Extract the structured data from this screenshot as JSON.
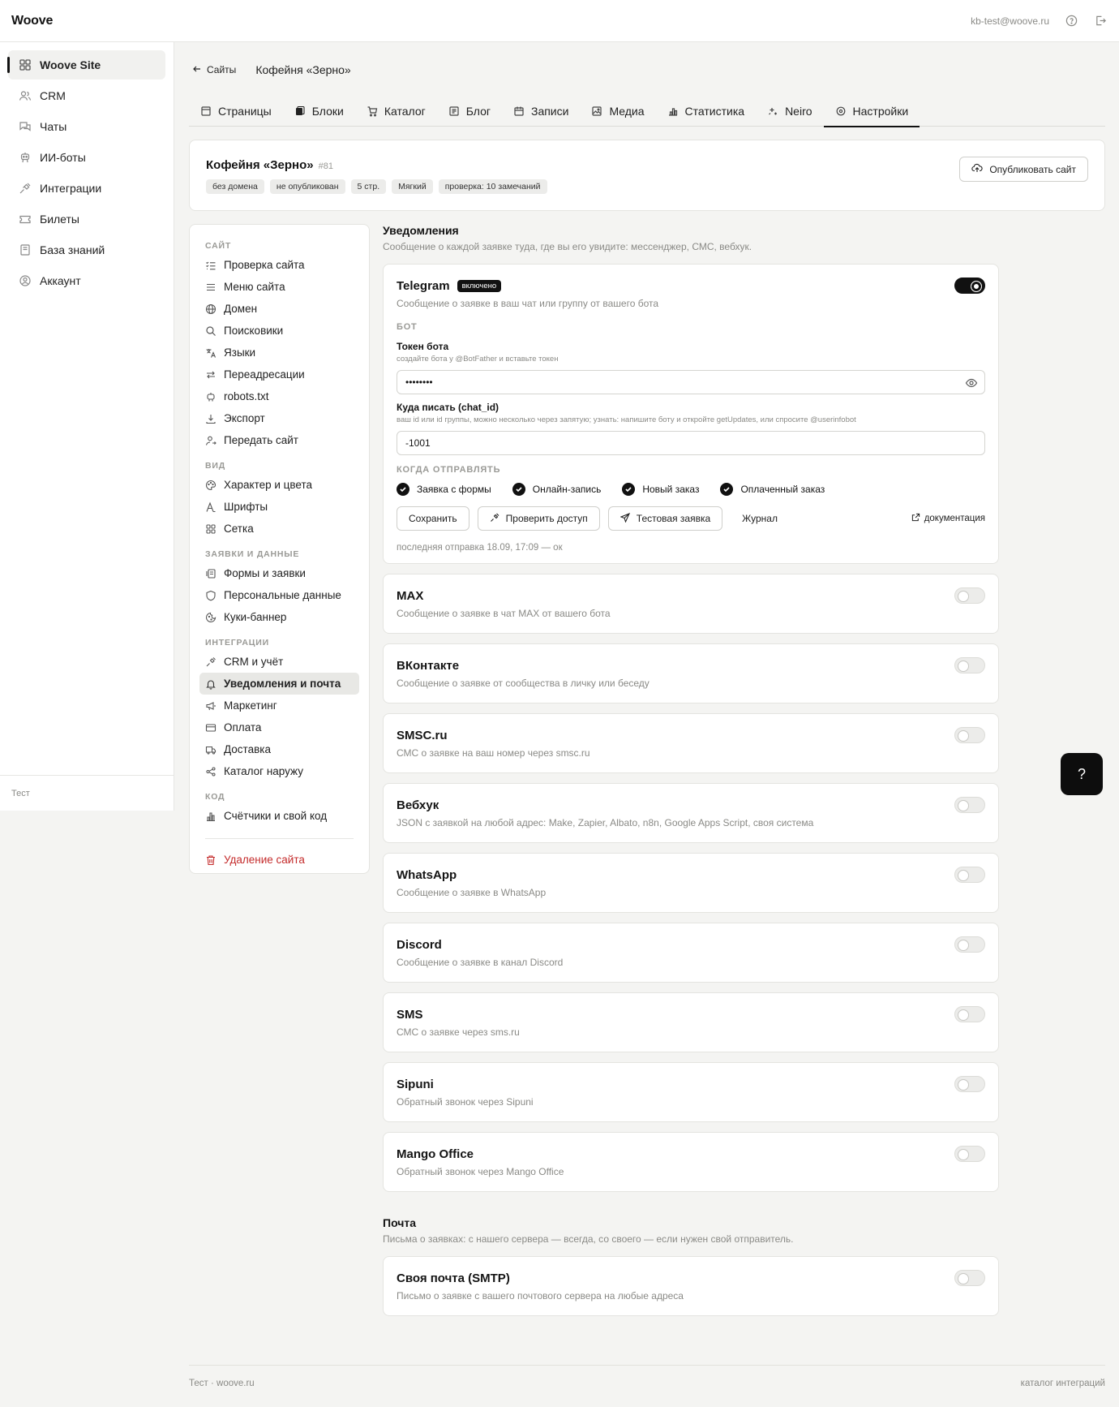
{
  "app": {
    "logo": "Woove",
    "user_email": "kb-test@woove.ru",
    "sidebar_footer": "Тест"
  },
  "sidebar": {
    "items": [
      {
        "label": "Woove Site",
        "icon": "grid-icon",
        "active": true
      },
      {
        "label": "CRM",
        "icon": "users-icon"
      },
      {
        "label": "Чаты",
        "icon": "chat-icon"
      },
      {
        "label": "ИИ-боты",
        "icon": "robot-icon"
      },
      {
        "label": "Интеграции",
        "icon": "plug-icon"
      },
      {
        "label": "Билеты",
        "icon": "ticket-icon"
      },
      {
        "label": "База знаний",
        "icon": "book-icon"
      },
      {
        "label": "Аккаунт",
        "icon": "account-icon"
      }
    ]
  },
  "breadcrumb": {
    "back_label": "Сайты",
    "title": "Кофейня «Зерно»"
  },
  "tabs": [
    {
      "label": "Страницы",
      "icon": "page-icon"
    },
    {
      "label": "Блоки",
      "icon": "blocks-icon"
    },
    {
      "label": "Каталог",
      "icon": "cart-icon"
    },
    {
      "label": "Блог",
      "icon": "blog-icon"
    },
    {
      "label": "Записи",
      "icon": "calendar-icon"
    },
    {
      "label": "Медиа",
      "icon": "image-icon"
    },
    {
      "label": "Статистика",
      "icon": "stats-icon"
    },
    {
      "label": "Neiro",
      "icon": "sparkle-icon"
    },
    {
      "label": "Настройки",
      "icon": "settings-icon",
      "active": true
    }
  ],
  "site": {
    "title": "Кофейня «Зерно»",
    "id": "#81",
    "chips": [
      "без домена",
      "не опубликован",
      "5 стр.",
      "Мягкий",
      "проверка: 10 замечаний"
    ],
    "publish_label": "Опубликовать сайт"
  },
  "settings_menu": {
    "sections": [
      {
        "title": "Сайт",
        "items": [
          {
            "label": "Проверка сайта",
            "icon": "checklist-icon"
          },
          {
            "label": "Меню сайта",
            "icon": "menu-icon"
          },
          {
            "label": "Домен",
            "icon": "globe-icon"
          },
          {
            "label": "Поисковики",
            "icon": "search-icon"
          },
          {
            "label": "Языки",
            "icon": "translate-icon"
          },
          {
            "label": "Переадресации",
            "icon": "redirect-icon"
          },
          {
            "label": "robots.txt",
            "icon": "robot-icon"
          },
          {
            "label": "Экспорт",
            "icon": "download-icon"
          },
          {
            "label": "Передать сайт",
            "icon": "user-transfer-icon"
          }
        ]
      },
      {
        "title": "Вид",
        "items": [
          {
            "label": "Характер и цвета",
            "icon": "palette-icon"
          },
          {
            "label": "Шрифты",
            "icon": "font-icon"
          },
          {
            "label": "Сетка",
            "icon": "grid-icon"
          }
        ]
      },
      {
        "title": "Заявки и данные",
        "items": [
          {
            "label": "Формы и заявки",
            "icon": "form-icon"
          },
          {
            "label": "Персональные данные",
            "icon": "shield-icon"
          },
          {
            "label": "Куки-баннер",
            "icon": "cookie-icon"
          }
        ]
      },
      {
        "title": "Интеграции",
        "items": [
          {
            "label": "CRM и учёт",
            "icon": "plug-icon"
          },
          {
            "label": "Уведомления и почта",
            "icon": "bell-icon",
            "active": true
          },
          {
            "label": "Маркетинг",
            "icon": "megaphone-icon"
          },
          {
            "label": "Оплата",
            "icon": "card-icon"
          },
          {
            "label": "Доставка",
            "icon": "truck-icon"
          },
          {
            "label": "Каталог наружу",
            "icon": "share-icon"
          }
        ]
      },
      {
        "title": "Код",
        "items": [
          {
            "label": "Счётчики и свой код",
            "icon": "chart-icon"
          }
        ]
      }
    ],
    "delete_label": "Удаление сайта"
  },
  "notifications": {
    "title": "Уведомления",
    "description": "Сообщение о каждой заявке туда, где вы его увидите: мессенджер, СМС, вебхук.",
    "telegram": {
      "title": "Telegram",
      "badge": "включено",
      "description": "Сообщение о заявке в ваш чат или группу от вашего бота",
      "enabled": true,
      "bot_section": "Бот",
      "token_label": "Токен бота",
      "token_hint": "создайте бота у @BotFather и вставьте токен",
      "token_value": "••••••••",
      "chat_label": "Куда писать (chat_id)",
      "chat_hint": "ваш id или id группы, можно несколько через запятую; узнать: напишите боту и откройте getUpdates, или спросите @userinfobot",
      "chat_value": "-1001",
      "when_section": "Когда отправлять",
      "triggers": [
        {
          "label": "Заявка с формы",
          "checked": true
        },
        {
          "label": "Онлайн-запись",
          "checked": true
        },
        {
          "label": "Новый заказ",
          "checked": true
        },
        {
          "label": "Оплаченный заказ",
          "checked": true
        }
      ],
      "save_label": "Сохранить",
      "check_label": "Проверить доступ",
      "test_label": "Тестовая заявка",
      "log_label": "Журнал",
      "docs_label": "документация",
      "last_sent": "последняя отправка 18.09, 17:09 — ок"
    },
    "channels": [
      {
        "title": "MAX",
        "description": "Сообщение о заявке в чат MAX от вашего бота",
        "enabled": false
      },
      {
        "title": "ВКонтакте",
        "description": "Сообщение о заявке от сообщества в личку или беседу",
        "enabled": false
      },
      {
        "title": "SMSC.ru",
        "description": "СМС о заявке на ваш номер через smsc.ru",
        "enabled": false
      },
      {
        "title": "Вебхук",
        "description": "JSON с заявкой на любой адрес: Make, Zapier, Albato, n8n, Google Apps Script, своя система",
        "enabled": false
      },
      {
        "title": "WhatsApp",
        "description": "Сообщение о заявке в WhatsApp",
        "enabled": false
      },
      {
        "title": "Discord",
        "description": "Сообщение о заявке в канал Discord",
        "enabled": false
      },
      {
        "title": "SMS",
        "description": "СМС о заявке через sms.ru",
        "enabled": false
      },
      {
        "title": "Sipuni",
        "description": "Обратный звонок через Sipuni",
        "enabled": false
      },
      {
        "title": "Mango Office",
        "description": "Обратный звонок через Mango Office",
        "enabled": false
      }
    ]
  },
  "mail": {
    "title": "Почта",
    "description": "Письма о заявках: с нашего сервера — всегда, со своего — если нужен свой отправитель.",
    "smtp": {
      "title": "Своя почта (SMTP)",
      "description": "Письмо о заявке с вашего почтового сервера на любые адреса",
      "enabled": false
    }
  },
  "help_label": "?",
  "footer": {
    "left": "Тест · woove.ru",
    "right": "каталог интеграций"
  }
}
